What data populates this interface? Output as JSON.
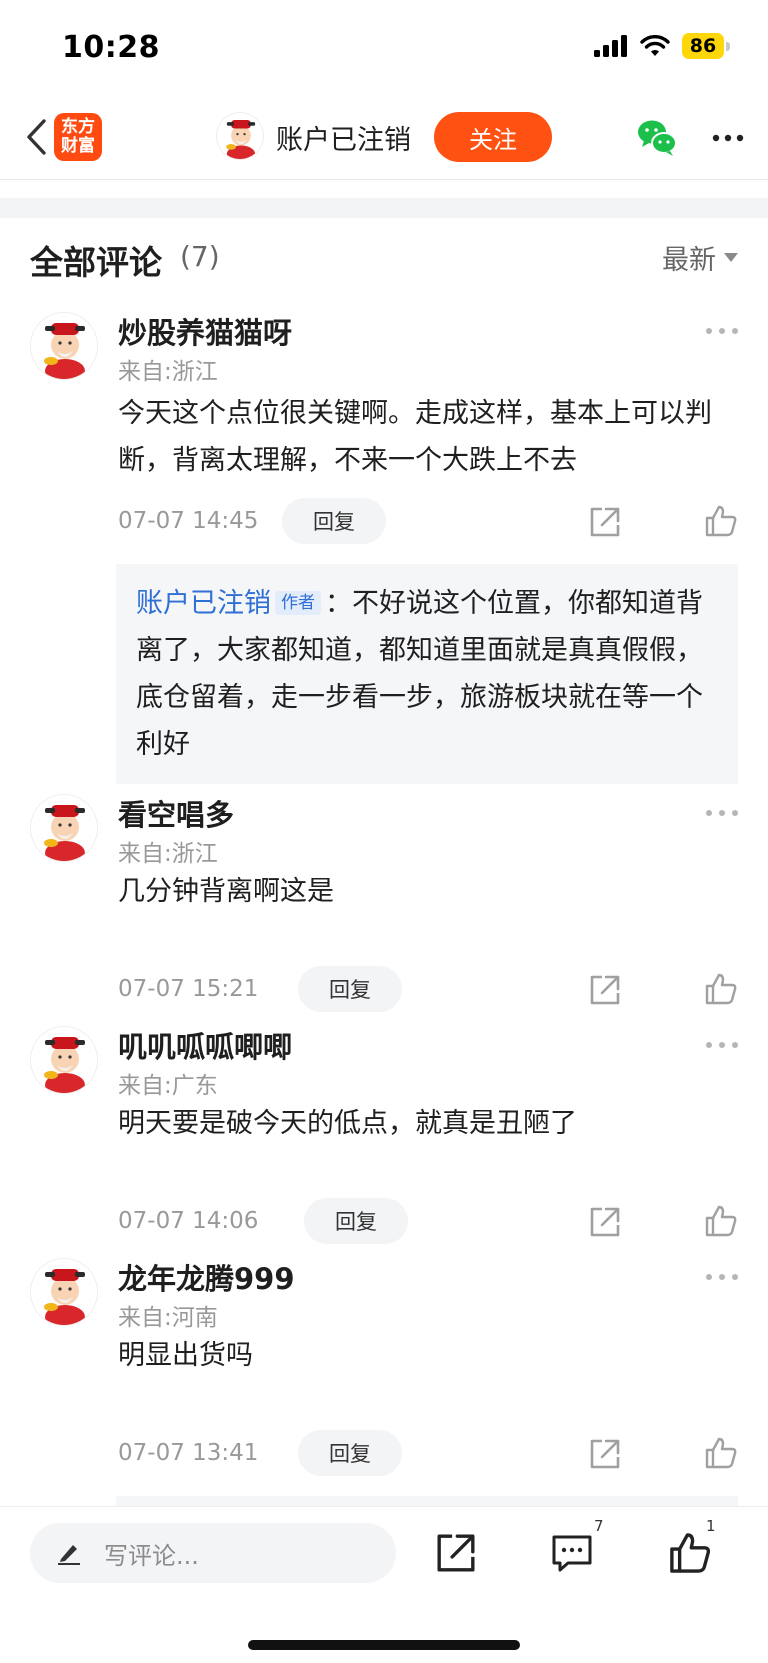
{
  "status_bar": {
    "time": "10:28",
    "battery": "86"
  },
  "nav": {
    "logo_line1": "东方",
    "logo_line2": "财富",
    "username": "账户已注销",
    "follow_label": "关注"
  },
  "comments_header": {
    "title": "全部评论",
    "count": "(7)",
    "sort": "最新"
  },
  "comments": [
    {
      "user": "炒股养猫猫呀",
      "location": "来自:浙江",
      "text": "今天这个点位很关键啊。走成这样，基本上可以判断，背离太理解，不来一个大跌上不去",
      "time": "07-07 14:45",
      "reply_label": "回复",
      "reply": {
        "author": "账户已注销",
        "badge": "作者",
        "separator": "：",
        "text": "不好说这个位置，你都知道背离了，大家都知道，都知道里面就是真真假假，底仓留着，走一步看一步，旅游板块就在等一个利好"
      }
    },
    {
      "user": "看空唱多",
      "location": "来自:浙江",
      "text": "几分钟背离啊这是",
      "time": "07-07 15:21",
      "reply_label": "回复"
    },
    {
      "user": "叽叽呱呱唧唧",
      "location": "来自:广东",
      "text": "明天要是破今天的低点，就真是丑陋了",
      "time": "07-07 14:06",
      "reply_label": "回复"
    },
    {
      "user": "龙年龙腾999",
      "location": "来自:河南",
      "text": "明显出货吗",
      "time": "07-07 13:41",
      "reply_label": "回复"
    }
  ],
  "bottom_bar": {
    "input_placeholder": "写评论...",
    "comment_count": "7",
    "like_count": "1"
  },
  "colors": {
    "accent": "#ff5212",
    "link": "#2f6fd6"
  }
}
